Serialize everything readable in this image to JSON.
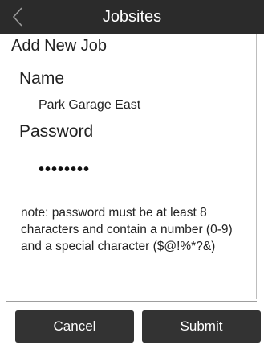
{
  "header": {
    "title": "Jobsites",
    "back_icon": "chevron-left-icon"
  },
  "form": {
    "title": "Add New Job",
    "name_label": "Name",
    "name_value": "Park Garage East",
    "password_label": "Password",
    "password_masked": "••••••••",
    "note": "note: password must be at least 8 characters and contain a number (0-9) and a special character ($@!%*?&)"
  },
  "actions": {
    "cancel_label": "Cancel",
    "submit_label": "Submit"
  },
  "colors": {
    "header_bg": "#2b2b2b",
    "button_bg": "#333333",
    "text": "#222222"
  }
}
